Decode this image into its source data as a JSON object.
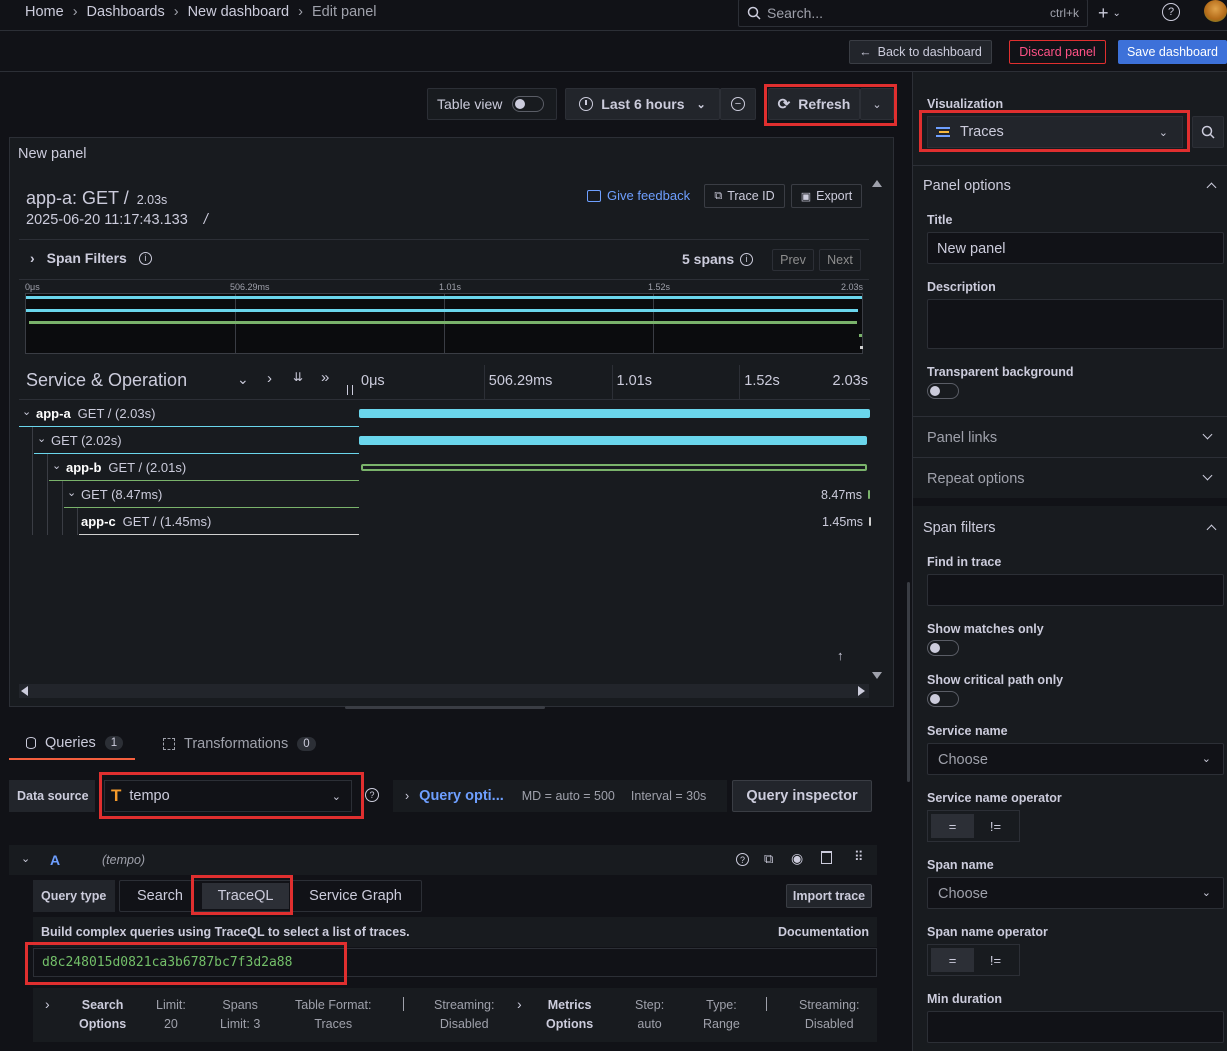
{
  "breadcrumb": [
    "Home",
    "Dashboards",
    "New dashboard",
    "Edit panel"
  ],
  "search": {
    "placeholder": "Search...",
    "shortcut": "ctrl+k"
  },
  "actions": {
    "back": "Back to dashboard",
    "discard": "Discard panel",
    "save": "Save dashboard"
  },
  "toolbar": {
    "table_view": "Table view",
    "time_range": "Last 6 hours",
    "refresh": "Refresh"
  },
  "panel": {
    "title": "New panel",
    "trace_title": "app-a: GET /",
    "duration": "2.03s",
    "timestamp": "2025-06-20 11:17:43.133",
    "slash": "/",
    "give_feedback": "Give feedback",
    "trace_id_btn": "Trace ID",
    "export_btn": "Export",
    "span_filters": "Span Filters",
    "spans_count": "5 spans",
    "prev": "Prev",
    "next": "Next",
    "minimap_ticks": [
      "0μs",
      "506.29ms",
      "1.01s",
      "1.52s",
      "2.03s"
    ],
    "service_operation": "Service & Operation",
    "timeline_ticks": [
      "0μs",
      "506.29ms",
      "1.01s",
      "1.52s",
      "2.03s"
    ],
    "spans": [
      {
        "service": "app-a",
        "op": "GET / (2.03s)",
        "start": 0.0,
        "width": 1.0,
        "color": "#6ad6ec",
        "label": ""
      },
      {
        "service": "",
        "op": "GET (2.02s)",
        "start": 0.0,
        "width": 0.995,
        "color": "#6ad6ec",
        "label": ""
      },
      {
        "service": "app-b",
        "op": "GET / (2.01s)",
        "start": 0.004,
        "width": 0.99,
        "color": "#7ab36b",
        "label": ""
      },
      {
        "service": "",
        "op": "GET (8.47ms)",
        "start": 0.996,
        "width": 0.004,
        "color": "#7ab36b",
        "label": "8.47ms"
      },
      {
        "service": "app-c",
        "op": "GET / (1.45ms)",
        "start": 0.998,
        "width": 0.002,
        "color": "#d0d0d0",
        "label": "1.45ms"
      }
    ]
  },
  "tabs": {
    "queries": "Queries",
    "queries_count": "1",
    "transformations": "Transformations",
    "transformations_count": "0"
  },
  "datasource": {
    "label": "Data source",
    "value": "tempo",
    "query_options": "Query opti...",
    "md": "MD = auto = 500",
    "interval": "Interval = 30s",
    "inspector": "Query inspector"
  },
  "query": {
    "ref": "A",
    "ds_hint": "(tempo)",
    "query_type_label": "Query type",
    "types": [
      "Search",
      "TraceQL",
      "Service Graph"
    ],
    "import_trace": "Import trace",
    "help": "Build complex queries using TraceQL to select a list of traces.",
    "documentation": "Documentation",
    "value": "d8c248015d0821ca3b6787bc7f3d2a88",
    "options": [
      {
        "k": "Search",
        "v": "Options",
        "bold": true
      },
      {
        "k": "Limit:",
        "v": "20"
      },
      {
        "k": "Spans",
        "v": "Limit: 3"
      },
      {
        "k": "Table Format:",
        "v": "Traces"
      },
      {
        "k": "Streaming:",
        "v": "Disabled"
      },
      {
        "k": "Metrics",
        "v": "Options",
        "bold": true
      },
      {
        "k": "Step:",
        "v": "auto"
      },
      {
        "k": "Type:",
        "v": "Range"
      },
      {
        "k": "Streaming:",
        "v": "Disabled"
      }
    ]
  },
  "options_pane": {
    "visualization_label": "Visualization",
    "visualization": "Traces",
    "panel_options": "Panel options",
    "title_label": "Title",
    "title_value": "New panel",
    "description_label": "Description",
    "transparent_label": "Transparent background",
    "panel_links": "Panel links",
    "repeat_options": "Repeat options",
    "span_filters": "Span filters",
    "find_in_trace": "Find in trace",
    "show_matches": "Show matches only",
    "show_critical": "Show critical path only",
    "service_name": "Service name",
    "choose": "Choose",
    "service_name_operator": "Service name operator",
    "eq": "=",
    "neq": "!=",
    "span_name": "Span name",
    "span_name_operator": "Span name operator",
    "min_duration": "Min duration"
  },
  "colors": {
    "accent": "#6e9fff",
    "primary": "#3d71d9",
    "danger": "#e02f2f",
    "cyan": "#6ad6ec",
    "green": "#7ab36b"
  }
}
